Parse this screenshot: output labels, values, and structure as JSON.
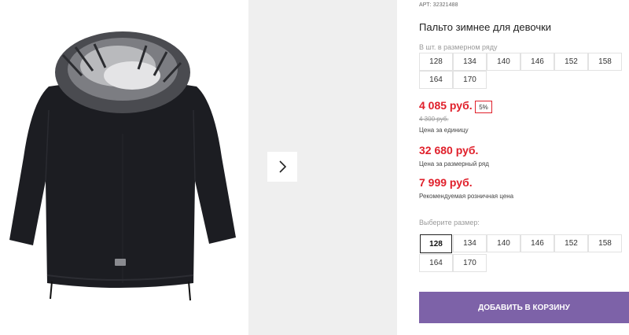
{
  "product": {
    "art_label": "АРТ:",
    "art_value": "32321488",
    "title": "Пальто зимнее для девочки"
  },
  "row_sizes": {
    "hint": "В шт. в размерном ряду",
    "items": [
      "128",
      "134",
      "140",
      "146",
      "152",
      "158",
      "164",
      "170"
    ]
  },
  "prices": {
    "unit_price": "4 085 руб.",
    "discount": "5%",
    "old_price": "4 300 руб.",
    "unit_caption": "Цена за единицу",
    "row_price": "32 680 руб.",
    "row_caption": "Цена за размерный ряд",
    "retail_price": "7 999 руб.",
    "retail_caption": "Рекомендуемая розничная цена"
  },
  "size_select": {
    "hint": "Выберите размер:",
    "items": [
      "128",
      "134",
      "140",
      "146",
      "152",
      "158",
      "164",
      "170"
    ],
    "selected": "128"
  },
  "cart": {
    "label": "ДОБАВИТЬ В КОРЗИНУ"
  },
  "colors": {
    "accent_price": "#e0202b",
    "cart_button": "#7d62a8",
    "gallery_bg": "#efefef"
  },
  "icons": {
    "next": "chevron-right-icon",
    "logo_patch": "logo-patch-icon"
  }
}
